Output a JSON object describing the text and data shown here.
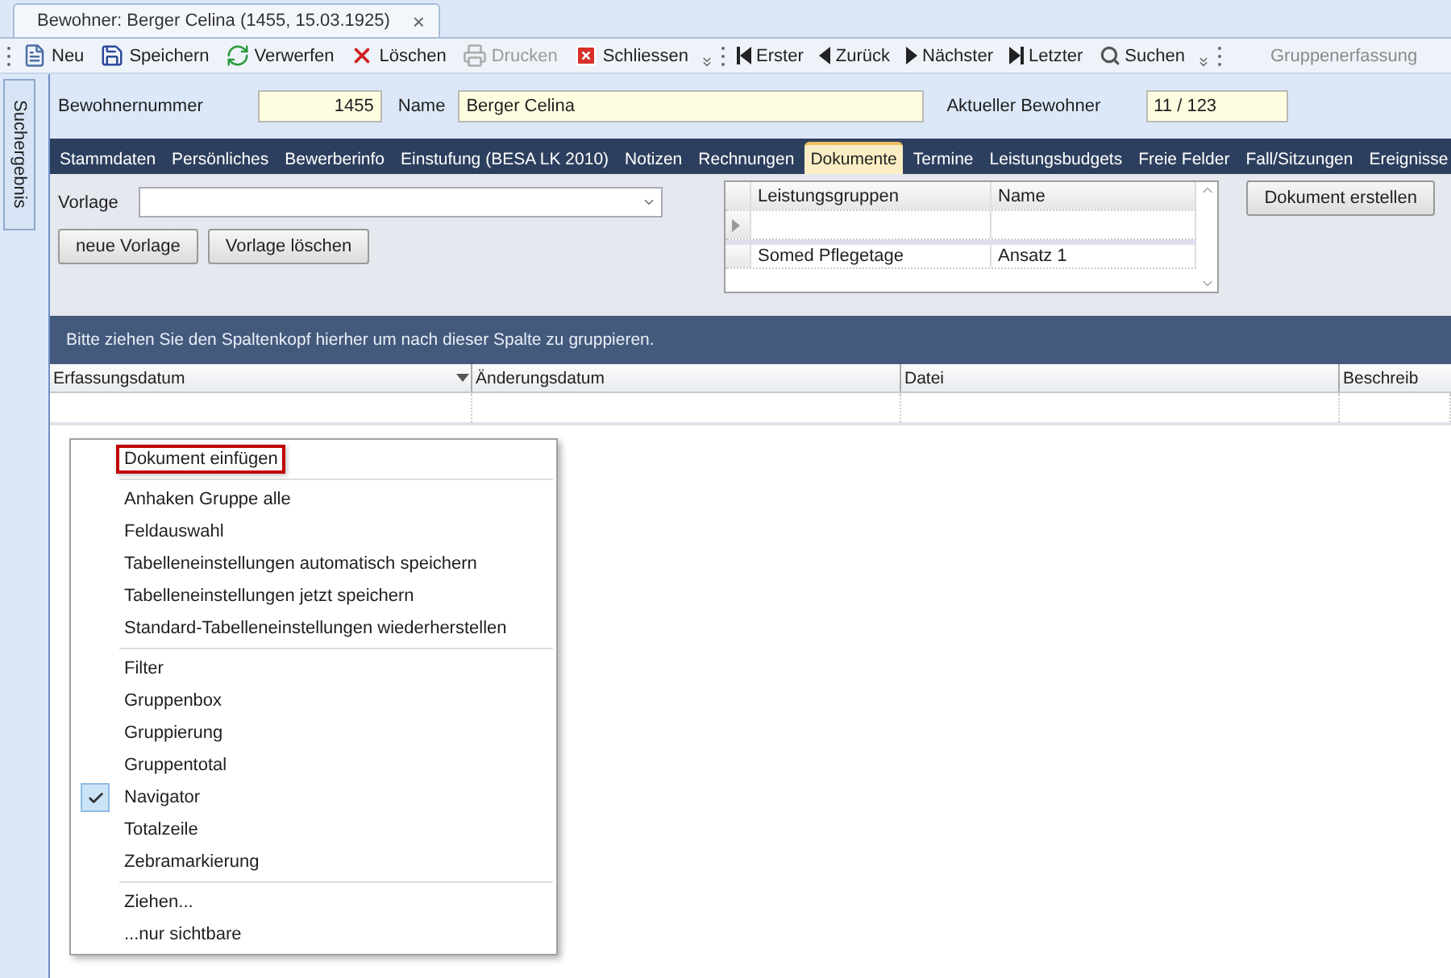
{
  "document_tab": {
    "title": "Bewohner: Berger Celina (1455, 15.03.1925)",
    "close": "×"
  },
  "toolbar": [
    {
      "label": "Neu",
      "disabled": false
    },
    {
      "label": "Speichern",
      "disabled": false
    },
    {
      "label": "Verwerfen",
      "disabled": false
    },
    {
      "label": "Löschen",
      "disabled": false
    },
    {
      "label": "Drucken",
      "disabled": true
    },
    {
      "label": "Schliessen",
      "disabled": false
    }
  ],
  "nav_toolbar": [
    {
      "label": "Erster"
    },
    {
      "label": "Zurück"
    },
    {
      "label": "Nächster"
    },
    {
      "label": "Letzter"
    },
    {
      "label": "Suchen"
    }
  ],
  "toolbar_right_label": "Gruppenerfassung",
  "side_tab": "Suchergebnis",
  "header": {
    "number_label": "Bewohnernummer",
    "number": "1455",
    "name_label": "Name",
    "name": "Berger Celina",
    "current_label": "Aktueller Bewohner",
    "current": "11 / 123"
  },
  "tabs": [
    {
      "label": "Stammdaten",
      "selected": false
    },
    {
      "label": "Persönliches",
      "selected": false
    },
    {
      "label": "Bewerberinfo",
      "selected": false
    },
    {
      "label": "Einstufung (BESA LK 2010)",
      "selected": false
    },
    {
      "label": "Notizen",
      "selected": false
    },
    {
      "label": "Rechnungen",
      "selected": false
    },
    {
      "label": "Dokumente",
      "selected": true
    },
    {
      "label": "Termine",
      "selected": false
    },
    {
      "label": "Leistungsbudgets",
      "selected": false
    },
    {
      "label": "Freie Felder",
      "selected": false
    },
    {
      "label": "Fall/Sitzungen",
      "selected": false
    },
    {
      "label": "Ereignisse",
      "selected": false
    }
  ],
  "template": {
    "label": "Vorlage",
    "buttons": [
      "neue Vorlage",
      "Vorlage löschen"
    ]
  },
  "service_grid": {
    "columns": [
      "Leistungsgruppen",
      "Name"
    ],
    "rows": [
      {
        "cells": [
          "Somed Pflegetage",
          "Ansatz 1"
        ]
      }
    ]
  },
  "create_button": "Dokument erstellen",
  "group_hint": "Bitte ziehen Sie den Spaltenkopf hierher um nach dieser Spalte zu gruppieren.",
  "documents_grid": {
    "columns": [
      {
        "label": "Erfassungsdatum",
        "sorted": true
      },
      {
        "label": "Änderungsdatum",
        "sorted": false
      },
      {
        "label": "Datei",
        "sorted": false
      },
      {
        "label": "Beschreib",
        "sorted": false
      }
    ]
  },
  "context_menu": [
    [
      {
        "label": "Dokument einfügen",
        "checked": false,
        "highlighted": true
      }
    ],
    [
      {
        "label": "Anhaken Gruppe alle",
        "checked": false,
        "highlighted": false
      },
      {
        "label": "Feldauswahl",
        "checked": false,
        "highlighted": false
      },
      {
        "label": "Tabelleneinstellungen automatisch speichern",
        "checked": false,
        "highlighted": false
      },
      {
        "label": "Tabelleneinstellungen jetzt speichern",
        "checked": false,
        "highlighted": false
      },
      {
        "label": "Standard-Tabelleneinstellungen wiederherstellen",
        "checked": false,
        "highlighted": false
      }
    ],
    [
      {
        "label": "Filter",
        "checked": false,
        "highlighted": false
      },
      {
        "label": "Gruppenbox",
        "checked": false,
        "highlighted": false
      },
      {
        "label": "Gruppierung",
        "checked": false,
        "highlighted": false
      },
      {
        "label": "Gruppentotal",
        "checked": false,
        "highlighted": false
      },
      {
        "label": "Navigator",
        "checked": true,
        "highlighted": false
      },
      {
        "label": "Totalzeile",
        "checked": false,
        "highlighted": false
      },
      {
        "label": "Zebramarkierung",
        "checked": false,
        "highlighted": false
      }
    ],
    [
      {
        "label": "Ziehen...",
        "checked": false,
        "highlighted": false
      },
      {
        "label": "...nur sichtbare",
        "checked": false,
        "highlighted": false
      }
    ]
  ]
}
